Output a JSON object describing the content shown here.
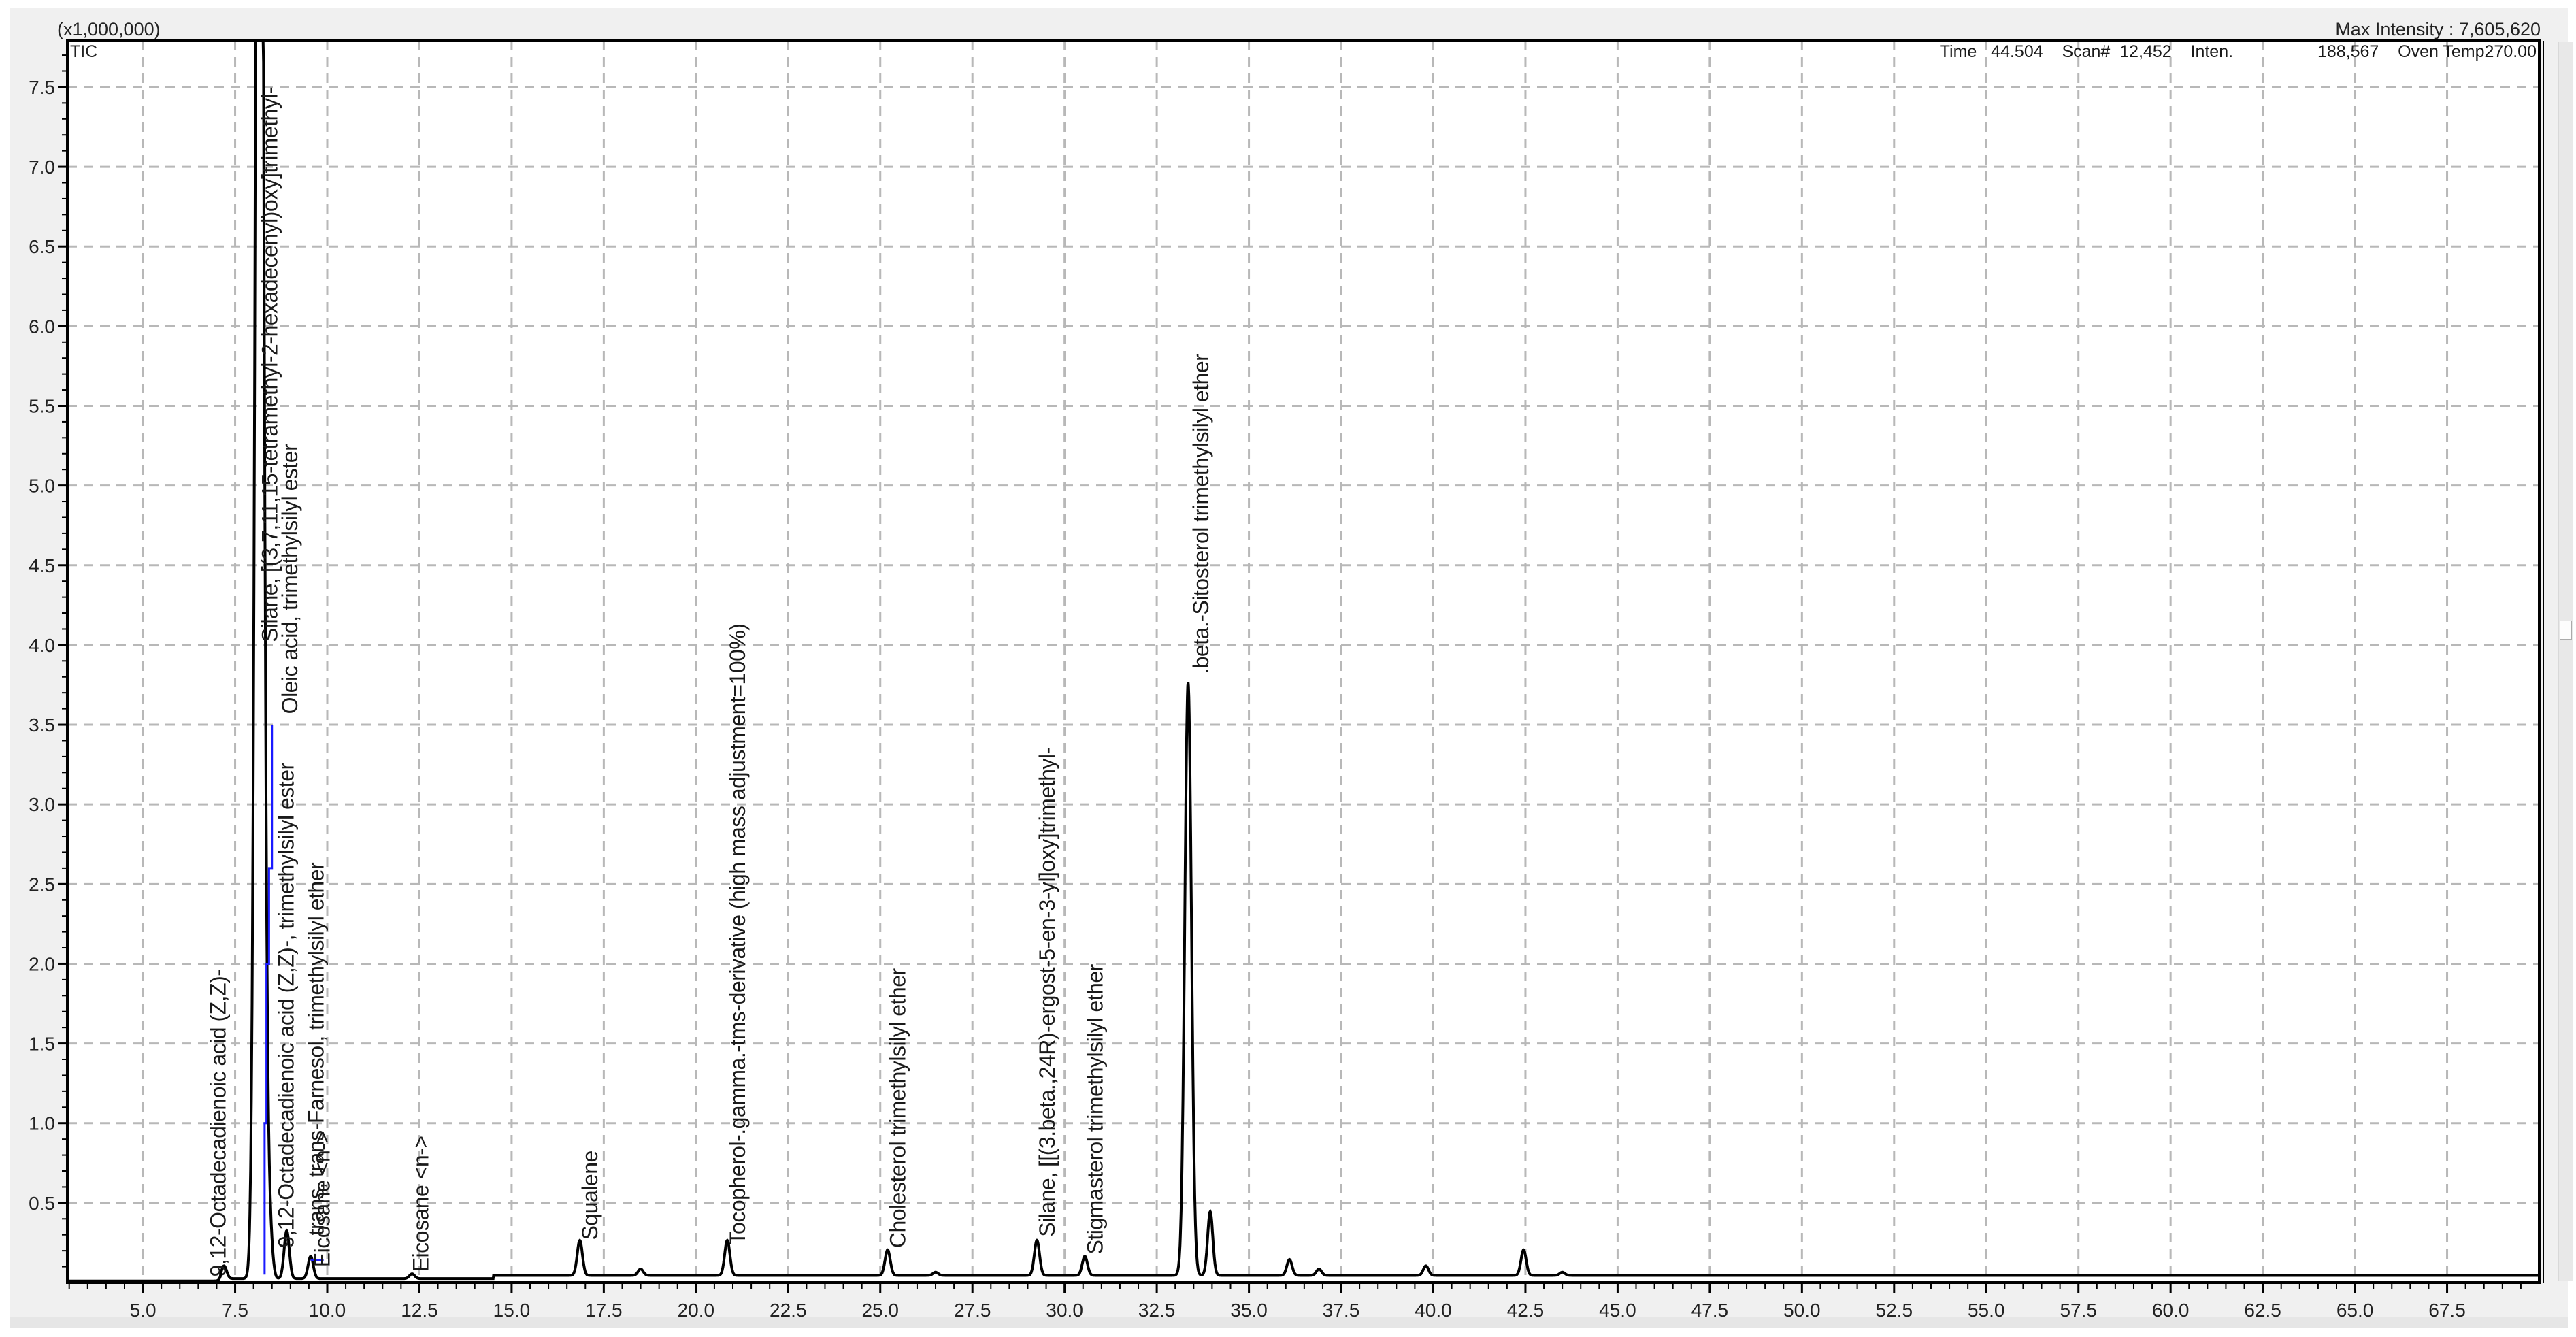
{
  "header": {
    "scale_label": "(x1,000,000)",
    "max_intensity": "Max Intensity : 7,605,620",
    "trace_label": "TIC",
    "cursor_info": {
      "time_label": "Time",
      "time_value": "44.504",
      "scan_label": "Scan#",
      "scan_value": "12,452",
      "inten_label": "Inten.",
      "inten_value": "188,567",
      "oven_label": "Oven Temp270.00"
    }
  },
  "chart_data": {
    "type": "line",
    "title": "TIC",
    "xlabel": "",
    "ylabel": "(x1,000,000)",
    "xlim": [
      2.95,
      70.0
    ],
    "ylim": [
      0,
      7.79
    ],
    "grid": true,
    "x_ticks": [
      "5.0",
      "7.5",
      "10.0",
      "12.5",
      "15.0",
      "17.5",
      "20.0",
      "22.5",
      "25.0",
      "27.5",
      "30.0",
      "32.5",
      "35.0",
      "37.5",
      "40.0",
      "42.5",
      "45.0",
      "47.5",
      "50.0",
      "52.5",
      "55.0",
      "57.5",
      "60.0",
      "62.5",
      "65.0",
      "67.5"
    ],
    "y_ticks": [
      "0.5",
      "1.0",
      "1.5",
      "2.0",
      "2.5",
      "3.0",
      "3.5",
      "4.0",
      "4.5",
      "5.0",
      "5.5",
      "6.0",
      "6.5",
      "7.0",
      "7.5"
    ],
    "peaks": [
      {
        "rt": 7.2,
        "height": 0.08
      },
      {
        "rt": 8.12,
        "height": 7.35
      },
      {
        "rt": 8.2,
        "height": 7.61
      },
      {
        "rt": 8.35,
        "height": 0.32
      },
      {
        "rt": 8.45,
        "height": 0.25
      },
      {
        "rt": 8.9,
        "height": 0.3
      },
      {
        "rt": 9.55,
        "height": 0.14
      },
      {
        "rt": 12.3,
        "height": 0.03
      },
      {
        "rt": 16.85,
        "height": 0.22
      },
      {
        "rt": 18.5,
        "height": 0.04
      },
      {
        "rt": 20.85,
        "height": 0.22
      },
      {
        "rt": 25.2,
        "height": 0.16
      },
      {
        "rt": 26.5,
        "height": 0.02
      },
      {
        "rt": 29.25,
        "height": 0.22
      },
      {
        "rt": 30.55,
        "height": 0.12
      },
      {
        "rt": 33.35,
        "height": 3.72
      },
      {
        "rt": 33.95,
        "height": 0.4
      },
      {
        "rt": 36.1,
        "height": 0.1
      },
      {
        "rt": 36.9,
        "height": 0.04
      },
      {
        "rt": 39.8,
        "height": 0.06
      },
      {
        "rt": 42.45,
        "height": 0.16
      },
      {
        "rt": 43.5,
        "height": 0.02
      }
    ],
    "annotations": [
      {
        "rt": 7.2,
        "text": "9,12-Octadecadienoic acid (Z,Z)-"
      },
      {
        "rt": 8.2,
        "text": "Silane, [(3,7,11,15-tetramethyl-2-hexadecenyl)oxy]trimethyl-"
      },
      {
        "rt": 8.45,
        "text": "Oleic acid, trimethylsilyl ester"
      },
      {
        "rt": 8.35,
        "text": "9,12-Octadecadienoic acid (Z,Z)-, trimethylsilyl ester"
      },
      {
        "rt": 8.9,
        "text": "trans, trans-Farnesol, trimethylsilyl ether"
      },
      {
        "rt": 9.55,
        "text": "Eicosane <n->"
      },
      {
        "rt": 12.3,
        "text": "Eicosane <n->"
      },
      {
        "rt": 16.85,
        "text": "Squalene"
      },
      {
        "rt": 20.85,
        "text": "Tocopherol-.gamma.-tms-derivative (high mass adjustment=100%)"
      },
      {
        "rt": 25.2,
        "text": "Cholesterol trimethylsilyl ether"
      },
      {
        "rt": 29.25,
        "text": "Silane, [[(3.beta.,24R)-ergost-5-en-3-yl]oxy]trimethyl-"
      },
      {
        "rt": 30.55,
        "text": "Stigmasterol trimethylsilyl ether"
      },
      {
        "rt": 33.35,
        "text": ".beta.-Sitosterol trimethylsilyl ether"
      }
    ],
    "colors": {
      "trace": "#000000",
      "grid": "#b8b8b8",
      "marker": "#1a1aff"
    }
  }
}
